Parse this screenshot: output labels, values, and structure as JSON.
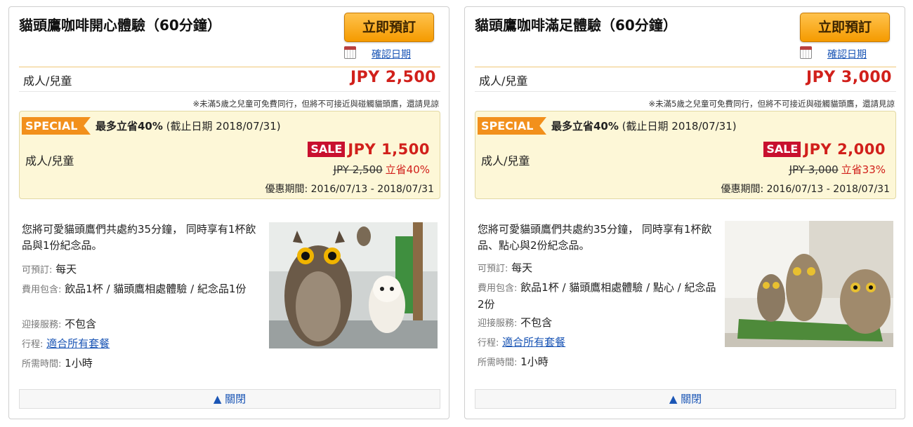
{
  "cards": [
    {
      "title": "貓頭鷹咖啡開心體驗（60分鐘）",
      "book_label": "立即預訂",
      "date_link": "確認日期",
      "price_label": "成人/兒童",
      "price": "JPY 2,500",
      "note": "※未滿5歲之兒童可免費同行，但將不可接近與碰觸貓頭鷹，還請見諒",
      "special": {
        "badge": "SPECIAL",
        "headline_bold": "最多立省40%",
        "headline_rest": " (截止日期 2018/07/31)",
        "label": "成人/兒童",
        "sale_badge": "SALE",
        "sale_price": "JPY 1,500",
        "original_price": "JPY 2,500",
        "save_text": "立省40%",
        "period": "優惠期間: 2016/07/13 - 2018/07/31"
      },
      "description": "您將可愛貓頭鷹們共處約35分鐘， 同時享有1杯飲品與1份紀念品。",
      "info": {
        "bookable_key": "可預訂:",
        "bookable_val": "每天",
        "includes_key": "費用包含:",
        "includes_val": "飲品1杯 / 貓頭鷹相處體驗 / 紀念品1份",
        "pickup_key": "迎接服務:",
        "pickup_val": "不包含",
        "itinerary_key": "行程:",
        "itinerary_link": "適合所有套餐",
        "duration_key": "所需時間:",
        "duration_val": "1小時"
      },
      "close_label": "▲ 關閉"
    },
    {
      "title": "貓頭鷹咖啡滿足體驗（60分鐘）",
      "book_label": "立即預訂",
      "date_link": "確認日期",
      "price_label": "成人/兒童",
      "price": "JPY 3,000",
      "note": "※未滿5歲之兒童可免費同行，但將不可接近與碰觸貓頭鷹，還請見諒",
      "special": {
        "badge": "SPECIAL",
        "headline_bold": "最多立省40%",
        "headline_rest": " (截止日期 2018/07/31)",
        "label": "成人/兒童",
        "sale_badge": "SALE",
        "sale_price": "JPY 2,000",
        "original_price": "JPY 3,000",
        "save_text": "立省33%",
        "period": "優惠期間: 2016/07/13 - 2018/07/31"
      },
      "description": "您將可愛貓頭鷹們共處約35分鐘， 同時享有1杯飲品、點心與2份紀念品。",
      "info": {
        "bookable_key": "可預訂:",
        "bookable_val": "每天",
        "includes_key": "費用包含:",
        "includes_val": "飲品1杯 / 貓頭鷹相處體驗 / 點心 / 紀念品2份",
        "pickup_key": "迎接服務:",
        "pickup_val": "不包含",
        "itinerary_key": "行程:",
        "itinerary_link": "適合所有套餐",
        "duration_key": "所需時間:",
        "duration_val": "1小時"
      },
      "close_label": "▲ 關閉"
    }
  ],
  "colors": {
    "price_red": "#d1201b",
    "book_button": "#f59b00",
    "special_bg": "#fdf7d7",
    "special_badge": "#f2901c",
    "sale_badge": "#c8102e",
    "link_blue": "#1a55b5"
  },
  "icons": {
    "calendar": "calendar-icon",
    "collapse": "triangle-up-icon"
  }
}
